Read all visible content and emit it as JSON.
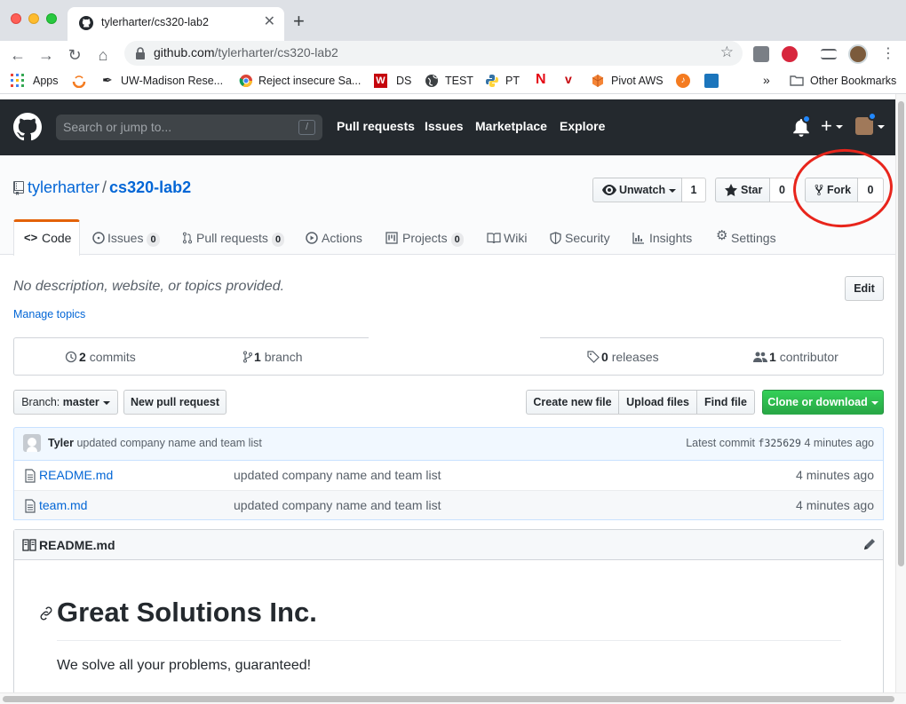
{
  "browser": {
    "tab_title": "tylerharter/cs320-lab2",
    "url_host": "github.com",
    "url_path": "/tylerharter/cs320-lab2",
    "bookmarks": [
      {
        "label": "Apps"
      },
      {
        "label": "UW-Madison Rese..."
      },
      {
        "label": "Reject insecure Sa..."
      },
      {
        "label": "DS"
      },
      {
        "label": "TEST"
      },
      {
        "label": "PT"
      },
      {
        "label": "Pivot AWS"
      }
    ],
    "overflow": "»",
    "other_bookmarks": "Other Bookmarks"
  },
  "gh_header": {
    "search_placeholder": "Search or jump to...",
    "search_key": "/",
    "nav": [
      "Pull requests",
      "Issues",
      "Marketplace",
      "Explore"
    ]
  },
  "repo": {
    "owner": "tylerharter",
    "separator": "/",
    "name": "cs320-lab2",
    "watch_label": "Unwatch",
    "watch_count": "1",
    "star_label": "Star",
    "star_count": "0",
    "fork_label": "Fork",
    "fork_count": "0"
  },
  "tabs": [
    {
      "label": "Code"
    },
    {
      "label": "Issues",
      "count": "0"
    },
    {
      "label": "Pull requests",
      "count": "0"
    },
    {
      "label": "Actions"
    },
    {
      "label": "Projects",
      "count": "0"
    },
    {
      "label": "Wiki"
    },
    {
      "label": "Security"
    },
    {
      "label": "Insights"
    },
    {
      "label": "Settings"
    }
  ],
  "about": {
    "description": "No description, website, or topics provided.",
    "edit_label": "Edit",
    "manage_topics": "Manage topics"
  },
  "summary": {
    "commits_num": "2",
    "commits_label": "commits",
    "branch_num": "1",
    "branch_label": "branch",
    "releases_num": "0",
    "releases_label": "releases",
    "contrib_num": "1",
    "contrib_label": "contributor"
  },
  "file_nav": {
    "branch_prefix": "Branch:",
    "branch_name": "master",
    "new_pr": "New pull request",
    "create_file": "Create new file",
    "upload_files": "Upload files",
    "find_file": "Find file",
    "clone": "Clone or download"
  },
  "commit": {
    "author": "Tyler",
    "message": "updated company name and team list",
    "latest_label": "Latest commit",
    "sha": "f325629",
    "age": "4 minutes ago"
  },
  "files": [
    {
      "name": "README.md",
      "message": "updated company name and team list",
      "age": "4 minutes ago"
    },
    {
      "name": "team.md",
      "message": "updated company name and team list",
      "age": "4 minutes ago"
    }
  ],
  "readme": {
    "filename": "README.md",
    "heading": "Great Solutions Inc.",
    "paragraph": "We solve all your problems, guaranteed!"
  },
  "colors": {
    "header_bg": "#24292e",
    "link": "#0366d6",
    "selected_tab_accent": "#e36209",
    "clone_button": "#28a745",
    "annotation_circle": "#e8251c"
  }
}
